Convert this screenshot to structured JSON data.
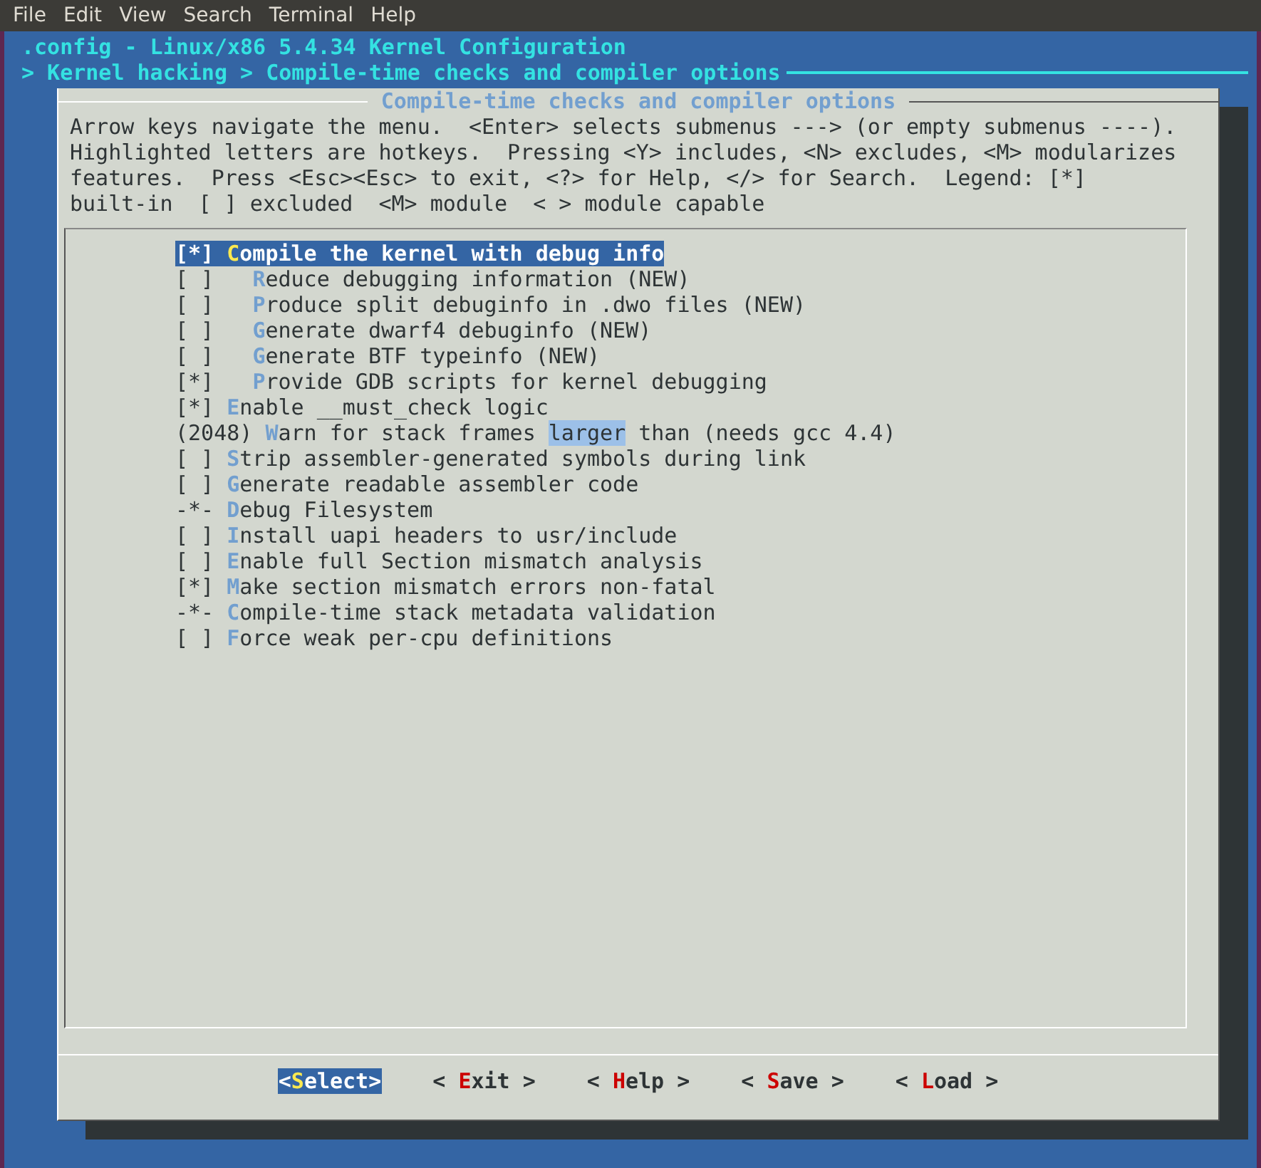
{
  "menubar": [
    "File",
    "Edit",
    "View",
    "Search",
    "Terminal",
    "Help"
  ],
  "header": {
    "title": ".config - Linux/x86 5.4.34 Kernel Configuration",
    "breadcrumb": "> Kernel hacking > Compile-time checks and compiler options"
  },
  "dialog": {
    "title": "Compile-time checks and compiler options",
    "help": [
      "Arrow keys navigate the menu.  <Enter> selects submenus ---> (or empty submenus ----).",
      "Highlighted letters are hotkeys.  Pressing <Y> includes, <N> excludes, <M> modularizes",
      "features.  Press <Esc><Esc> to exit, <?> for Help, </> for Search.  Legend: [*]",
      "built-in  [ ] excluded  <M> module  < > module capable"
    ],
    "items": [
      {
        "prefix": "[*] ",
        "hotkey": "C",
        "rest": "ompile the kernel with debug info",
        "selected": true
      },
      {
        "prefix": "[ ]   ",
        "hotkey": "R",
        "rest": "educe debugging information (NEW)",
        "selected": false
      },
      {
        "prefix": "[ ]   ",
        "hotkey": "P",
        "rest": "roduce split debuginfo in .dwo files (NEW)",
        "selected": false
      },
      {
        "prefix": "[ ]   ",
        "hotkey": "G",
        "rest": "enerate dwarf4 debuginfo (NEW)",
        "selected": false
      },
      {
        "prefix": "[ ]   ",
        "hotkey": "G",
        "rest": "enerate BTF typeinfo (NEW)",
        "selected": false
      },
      {
        "prefix": "[*]   ",
        "hotkey": "P",
        "rest": "rovide GDB scripts for kernel debugging",
        "selected": false
      },
      {
        "prefix": "[*] ",
        "hotkey": "E",
        "rest": "nable __must_check logic",
        "selected": false
      },
      {
        "prefix": "(2048) ",
        "hotkey": "W",
        "rest": "arn for stack frames ",
        "match": "larger",
        "after": " than (needs gcc 4.4)",
        "selected": false
      },
      {
        "prefix": "[ ] ",
        "hotkey": "S",
        "rest": "trip assembler-generated symbols during link",
        "selected": false
      },
      {
        "prefix": "[ ] ",
        "hotkey": "G",
        "rest": "enerate readable assembler code",
        "selected": false
      },
      {
        "prefix": "-*- ",
        "hotkey": "D",
        "rest": "ebug Filesystem",
        "selected": false
      },
      {
        "prefix": "[ ] ",
        "hotkey": "I",
        "rest": "nstall uapi headers to usr/include",
        "selected": false
      },
      {
        "prefix": "[ ] ",
        "hotkey": "E",
        "rest": "nable full Section mismatch analysis",
        "selected": false
      },
      {
        "prefix": "[*] ",
        "hotkey": "M",
        "rest": "ake section mismatch errors non-fatal",
        "selected": false
      },
      {
        "prefix": "-*- ",
        "hotkey": "C",
        "rest": "ompile-time stack metadata validation",
        "selected": false
      },
      {
        "prefix": "[ ] ",
        "hotkey": "F",
        "rest": "orce weak per-cpu definitions",
        "selected": false
      }
    ],
    "buttons": [
      {
        "before": "<",
        "hotkey": "S",
        "after": "elect>",
        "selected": true
      },
      {
        "before": "< ",
        "hotkey": "E",
        "after": "xit >",
        "selected": false
      },
      {
        "before": "< ",
        "hotkey": "H",
        "after": "elp >",
        "selected": false
      },
      {
        "before": "< ",
        "hotkey": "S",
        "after": "ave >",
        "selected": false
      },
      {
        "before": "< ",
        "hotkey": "L",
        "after": "oad >",
        "selected": false
      }
    ]
  }
}
